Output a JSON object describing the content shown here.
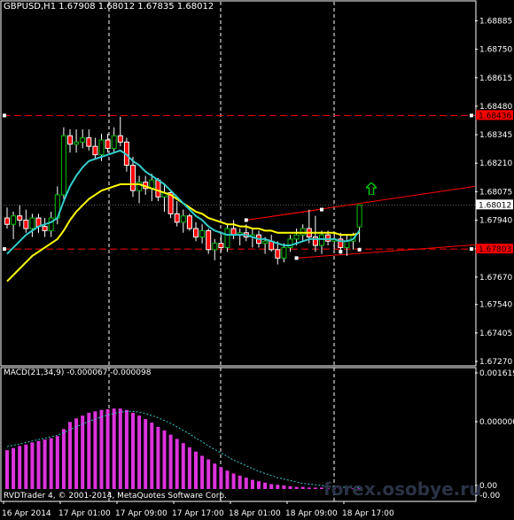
{
  "window": {
    "title": "GBPUSD,H1  1.67908 1.68012 1.67835 1.68012",
    "macd_label": "MACD(21,34,9) -0.000067 -0.000098",
    "footer": "RVDTrader 4, © 2001-2014, MetaQuotes Software Corp.",
    "watermark": "forex.osobye.ru"
  },
  "colors": {
    "background": "#000000",
    "grid": "#ffffff",
    "bull": "#00c000",
    "bear": "#ff0000",
    "ma_fast": "#33cccc",
    "ma_slow": "#ffff00",
    "macd_hist": "#dd33dd",
    "macd_signal": "#33cccc",
    "level_line": "#ff0000",
    "channel": "#ff0000"
  },
  "price_axis": {
    "labels": [
      "1.68885",
      "1.68750",
      "1.68615",
      "1.68480",
      "1.68345",
      "1.68210",
      "1.68075",
      "1.67940",
      "1.67805",
      "1.67670",
      "1.67540",
      "1.67405",
      "1.67270"
    ],
    "highlight_upper": "1.68436",
    "highlight_last": "1.68012",
    "highlight_lower": "1.67803"
  },
  "macd_axis": {
    "labels": [
      "0.001619",
      "0.000000",
      "0.00",
      "-0.00"
    ]
  },
  "time_axis": {
    "labels": [
      "16 Apr 2014",
      "17 Apr 01:00",
      "17 Apr 09:00",
      "17 Apr 17:00",
      "18 Apr 01:00",
      "18 Apr 09:00",
      "18 Apr 17:00"
    ]
  },
  "chart_data": {
    "type": "candlestick",
    "symbol": "GBPUSD",
    "timeframe": "H1",
    "ylim": [
      1.6727,
      1.6895
    ],
    "levels": [
      1.68436,
      1.67803
    ],
    "last_price": 1.68012,
    "candles": [
      [
        1.6795,
        1.68,
        1.679,
        1.6792
      ],
      [
        1.6792,
        1.6798,
        1.6785,
        1.6796
      ],
      [
        1.6796,
        1.6801,
        1.6791,
        1.6794
      ],
      [
        1.6794,
        1.6799,
        1.6788,
        1.679
      ],
      [
        1.679,
        1.6797,
        1.6786,
        1.6795
      ],
      [
        1.6795,
        1.6797,
        1.6788,
        1.6791
      ],
      [
        1.6791,
        1.6795,
        1.6786,
        1.6789
      ],
      [
        1.6789,
        1.6798,
        1.6786,
        1.6795
      ],
      [
        1.6795,
        1.681,
        1.6792,
        1.6806
      ],
      [
        1.6806,
        1.6838,
        1.6804,
        1.6834
      ],
      [
        1.6834,
        1.6837,
        1.6826,
        1.683
      ],
      [
        1.683,
        1.6837,
        1.6826,
        1.6831
      ],
      [
        1.6831,
        1.6837,
        1.6828,
        1.6833
      ],
      [
        1.6833,
        1.6837,
        1.6827,
        1.6829
      ],
      [
        1.6829,
        1.6833,
        1.6823,
        1.6825
      ],
      [
        1.6825,
        1.6835,
        1.6822,
        1.6832
      ],
      [
        1.6832,
        1.6835,
        1.6826,
        1.6828
      ],
      [
        1.6828,
        1.6838,
        1.6826,
        1.6834
      ],
      [
        1.6834,
        1.6843,
        1.6829,
        1.6831
      ],
      [
        1.6831,
        1.6833,
        1.6817,
        1.682
      ],
      [
        1.682,
        1.6824,
        1.6805,
        1.6808
      ],
      [
        1.6808,
        1.6815,
        1.6802,
        1.6812
      ],
      [
        1.6812,
        1.6815,
        1.6806,
        1.6809
      ],
      [
        1.6809,
        1.6816,
        1.6803,
        1.6813
      ],
      [
        1.6813,
        1.6814,
        1.6803,
        1.6805
      ],
      [
        1.6805,
        1.6811,
        1.6798,
        1.6807
      ],
      [
        1.6807,
        1.6808,
        1.6795,
        1.6797
      ],
      [
        1.6797,
        1.6803,
        1.6791,
        1.6793
      ],
      [
        1.6793,
        1.6799,
        1.6788,
        1.6796
      ],
      [
        1.6796,
        1.6797,
        1.6789,
        1.679
      ],
      [
        1.679,
        1.6793,
        1.6784,
        1.6786
      ],
      [
        1.6786,
        1.6792,
        1.6783,
        1.6789
      ],
      [
        1.6789,
        1.679,
        1.6778,
        1.678
      ],
      [
        1.678,
        1.6785,
        1.6775,
        1.6783
      ],
      [
        1.6783,
        1.6787,
        1.6779,
        1.6781
      ],
      [
        1.6781,
        1.6792,
        1.6779,
        1.679
      ],
      [
        1.679,
        1.6794,
        1.6785,
        1.6787
      ],
      [
        1.6787,
        1.679,
        1.6782,
        1.6788
      ],
      [
        1.6788,
        1.6792,
        1.6784,
        1.6786
      ],
      [
        1.6786,
        1.679,
        1.6781,
        1.6787
      ],
      [
        1.6787,
        1.6789,
        1.6781,
        1.6783
      ],
      [
        1.6783,
        1.6786,
        1.6778,
        1.6784
      ],
      [
        1.6784,
        1.6787,
        1.6779,
        1.678
      ],
      [
        1.678,
        1.6784,
        1.6773,
        1.6776
      ],
      [
        1.6776,
        1.6783,
        1.6774,
        1.6781
      ],
      [
        1.6781,
        1.6787,
        1.6779,
        1.6785
      ],
      [
        1.6785,
        1.679,
        1.6782,
        1.6787
      ],
      [
        1.6787,
        1.6792,
        1.6784,
        1.679
      ],
      [
        1.679,
        1.6799,
        1.6783,
        1.6786
      ],
      [
        1.6786,
        1.6796,
        1.6779,
        1.6782
      ],
      [
        1.6782,
        1.6789,
        1.6778,
        1.6787
      ],
      [
        1.6787,
        1.6789,
        1.6782,
        1.6784
      ],
      [
        1.6784,
        1.6788,
        1.678,
        1.6785
      ],
      [
        1.6785,
        1.6788,
        1.6778,
        1.6781
      ],
      [
        1.6781,
        1.6787,
        1.6777,
        1.6784
      ],
      [
        1.6784,
        1.6788,
        1.678,
        1.6787
      ],
      [
        1.67908,
        1.68012,
        1.67835,
        1.68012
      ]
    ],
    "ma_fast": [
      1.6778,
      1.6781,
      1.6784,
      1.6787,
      1.6789,
      1.6791,
      1.6792,
      1.6793,
      1.6795,
      1.6803,
      1.681,
      1.6815,
      1.6819,
      1.6822,
      1.6823,
      1.6824,
      1.6825,
      1.6826,
      1.6827,
      1.6825,
      1.6822,
      1.682,
      1.6817,
      1.6815,
      1.6813,
      1.6811,
      1.6808,
      1.6805,
      1.6802,
      1.6799,
      1.6796,
      1.6794,
      1.6791,
      1.6789,
      1.6788,
      1.6787,
      1.6787,
      1.6787,
      1.6787,
      1.6786,
      1.6785,
      1.6785,
      1.6784,
      1.6783,
      1.6782,
      1.6782,
      1.6783,
      1.6784,
      1.6785,
      1.6785,
      1.6785,
      1.6785,
      1.6785,
      1.6784,
      1.6784,
      1.6785,
      1.6789
    ],
    "ma_slow": [
      1.6765,
      1.6768,
      1.6771,
      1.6774,
      1.6777,
      1.6779,
      1.6781,
      1.6783,
      1.6785,
      1.6789,
      1.6794,
      1.6798,
      1.6801,
      1.6804,
      1.6806,
      1.6808,
      1.6809,
      1.681,
      1.6811,
      1.6811,
      1.6811,
      1.6811,
      1.681,
      1.6809,
      1.6808,
      1.6807,
      1.6806,
      1.6804,
      1.6802,
      1.68,
      1.6798,
      1.6797,
      1.6795,
      1.6794,
      1.6793,
      1.6792,
      1.6792,
      1.6791,
      1.6791,
      1.679,
      1.679,
      1.6789,
      1.6789,
      1.6788,
      1.6788,
      1.6788,
      1.6788,
      1.6788,
      1.6788,
      1.6788,
      1.6788,
      1.6788,
      1.6788,
      1.6787,
      1.6787,
      1.6787,
      1.6788
    ],
    "macd_hist_ylim": [
      0,
      0.001619
    ],
    "macd_hist": [
      0.00055,
      0.00058,
      0.00061,
      0.00063,
      0.00066,
      0.00068,
      0.0007,
      0.00072,
      0.00075,
      0.00085,
      0.00095,
      0.001,
      0.00104,
      0.00108,
      0.0011,
      0.00112,
      0.00113,
      0.00114,
      0.00114,
      0.00112,
      0.00108,
      0.00104,
      0.00099,
      0.00094,
      0.00088,
      0.00083,
      0.00077,
      0.00071,
      0.00065,
      0.00059,
      0.00053,
      0.00047,
      0.00042,
      0.00036,
      0.00031,
      0.00026,
      0.00022,
      0.00019,
      0.00016,
      0.00013,
      0.00011,
      9e-05,
      7e-05,
      6e-05,
      5e-05,
      4e-05,
      3e-05,
      3e-05,
      2e-05,
      2e-05,
      2e-05,
      1e-05,
      1e-05,
      1e-05,
      1e-05,
      1e-05,
      1e-05
    ],
    "macd_signal": [
      0.0006,
      0.00062,
      0.00064,
      0.00066,
      0.00068,
      0.0007,
      0.00072,
      0.00074,
      0.00076,
      0.0008,
      0.00084,
      0.00088,
      0.00092,
      0.00096,
      0.00099,
      0.00102,
      0.00105,
      0.00107,
      0.00109,
      0.0011,
      0.0011,
      0.00109,
      0.00107,
      0.00104,
      0.00101,
      0.00097,
      0.00093,
      0.00088,
      0.00083,
      0.00078,
      0.00072,
      0.00067,
      0.00061,
      0.00056,
      0.00051,
      0.00046,
      0.00041,
      0.00037,
      0.00033,
      0.00029,
      0.00025,
      0.00022,
      0.00019,
      0.00016,
      0.00014,
      0.00012,
      0.0001,
      8e-05,
      7e-05,
      6e-05,
      5e-05,
      4e-05,
      3e-05,
      3e-05,
      2e-05,
      2e-05,
      2e-05
    ]
  }
}
